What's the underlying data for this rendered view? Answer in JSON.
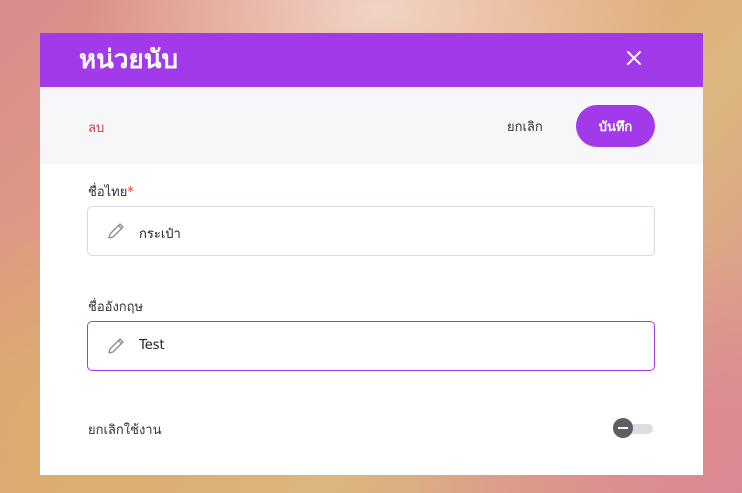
{
  "dialog": {
    "title": "หน่วยนับ",
    "close_icon": "close-icon"
  },
  "toolbar": {
    "delete_label": "ลบ",
    "cancel_label": "ยกเลิก",
    "save_label": "บันทึก"
  },
  "form": {
    "thai_name": {
      "label": "ชื่อไทย",
      "required_mark": "*",
      "value": "กระเป๋า",
      "icon": "pencil-icon"
    },
    "english_name": {
      "label": "ชื่ออังกฤษ",
      "value": "Test",
      "icon": "pencil-icon"
    },
    "disable_toggle": {
      "label": "ยกเลิกใช้งาน",
      "checked": false
    }
  },
  "colors": {
    "accent": "#a33ae9",
    "danger": "#d23b3b"
  }
}
